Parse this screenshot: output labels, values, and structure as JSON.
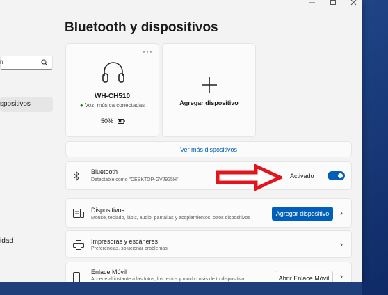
{
  "window": {
    "title": "Bluetooth y dispositivos"
  },
  "sidebar": {
    "search_placeholder": "n",
    "selected_item": "spositivos",
    "item2": "idad"
  },
  "device_card": {
    "name": "WH-CH510",
    "status": "Voz, música conectadas",
    "battery": "50%",
    "more": "···"
  },
  "add_card": {
    "label": "Agregar dispositivo"
  },
  "see_more": "Ver más dispositivos",
  "bluetooth": {
    "title": "Bluetooth",
    "subtitle": "Detectable como \"DESKTOP-GVJ925H\"",
    "state": "Activado",
    "toggle_on": true
  },
  "devices_row": {
    "title": "Dispositivos",
    "subtitle": "Mouse, teclado, lápiz, audio, pantallas y acoplamientos, otros dispositivos",
    "button": "Agregar dispositivo"
  },
  "printers_row": {
    "title": "Impresoras y escáneres",
    "subtitle": "Preferencias, solucionar problemas"
  },
  "phone_row": {
    "title": "Enlace Móvil",
    "subtitle": "Accede al instante a las fotos, los textos y mucho más de tu dispositivo",
    "button": "Abrir Enlace Móvil"
  },
  "colors": {
    "accent": "#005fb8",
    "annotation_arrow": "#e3151c"
  }
}
